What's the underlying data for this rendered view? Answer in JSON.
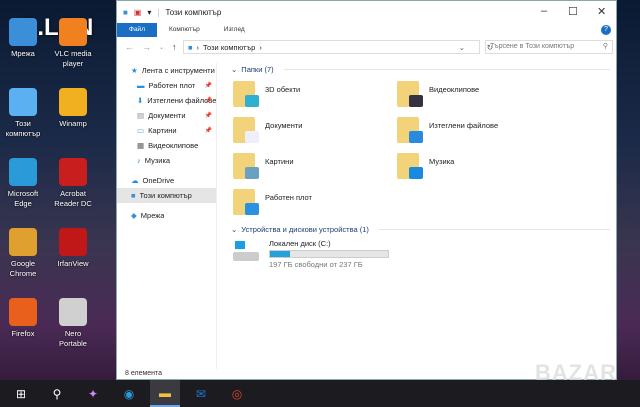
{
  "watermark_logo": "C.LAN",
  "desktop": {
    "icons": [
      {
        "label": "Мрежа",
        "color": "#3a8fd8"
      },
      {
        "label": "VLC media player",
        "color": "#f08020"
      },
      {
        "label": "Този компютър",
        "color": "#5ab0f0"
      },
      {
        "label": "Winamp",
        "color": "#f0b020"
      },
      {
        "label": "Microsoft Edge",
        "color": "#2a9ad8"
      },
      {
        "label": "Acrobat Reader DC",
        "color": "#c81e1e"
      },
      {
        "label": "Google Chrome",
        "color": "#e0a030"
      },
      {
        "label": "IrfanView",
        "color": "#c01818"
      },
      {
        "label": "Firefox",
        "color": "#e8601c"
      },
      {
        "label": "Nero Portable",
        "color": "#d0d0d0"
      }
    ]
  },
  "window": {
    "title": "Този компютър",
    "tabs": [
      "Файл",
      "Компютър",
      "Изглед"
    ],
    "address": "Този компютър",
    "search_placeholder": "Търсене в Този компютър",
    "nav": [
      {
        "label": "Лента с инструменти",
        "icon": "star-icon"
      },
      {
        "label": "Работен плот",
        "icon": "desktop-icon",
        "pinned": true
      },
      {
        "label": "Изтеглени файлове",
        "icon": "download-icon",
        "pinned": true
      },
      {
        "label": "Документи",
        "icon": "document-icon",
        "pinned": true
      },
      {
        "label": "Картини",
        "icon": "pictures-icon",
        "pinned": true
      },
      {
        "label": "Видеоклипове",
        "icon": "video-icon"
      },
      {
        "label": "Музика",
        "icon": "music-icon"
      },
      {
        "label": "OneDrive",
        "icon": "cloud-icon"
      },
      {
        "label": "Този компютър",
        "icon": "computer-icon",
        "selected": true
      },
      {
        "label": "Мрежа",
        "icon": "network-icon"
      }
    ],
    "folders_header": "Папки (7)",
    "folders": [
      {
        "label": "3D обекти",
        "overlay": "#2fb0d0"
      },
      {
        "label": "Видеоклипове",
        "overlay": "#334"
      },
      {
        "label": "Документи",
        "overlay": "#eef"
      },
      {
        "label": "Изтеглени файлове",
        "overlay": "#2a8ae0"
      },
      {
        "label": "Картини",
        "overlay": "#6aa0c0"
      },
      {
        "label": "Музика",
        "overlay": "#1a8ae0"
      },
      {
        "label": "Работен плот",
        "overlay": "#2a90e0"
      }
    ],
    "devices_header": "Устройства и дискови устройства (1)",
    "drive": {
      "label": "Локален диск (C:)",
      "free": "197 ГБ свободни от 237 ГБ",
      "used_fraction": 0.17
    },
    "status": "8 елемента"
  },
  "taskbar": [
    "start",
    "search",
    "copilot",
    "edge",
    "explorer",
    "outlook",
    "chrome"
  ],
  "bazar_watermark": "BAZAR"
}
